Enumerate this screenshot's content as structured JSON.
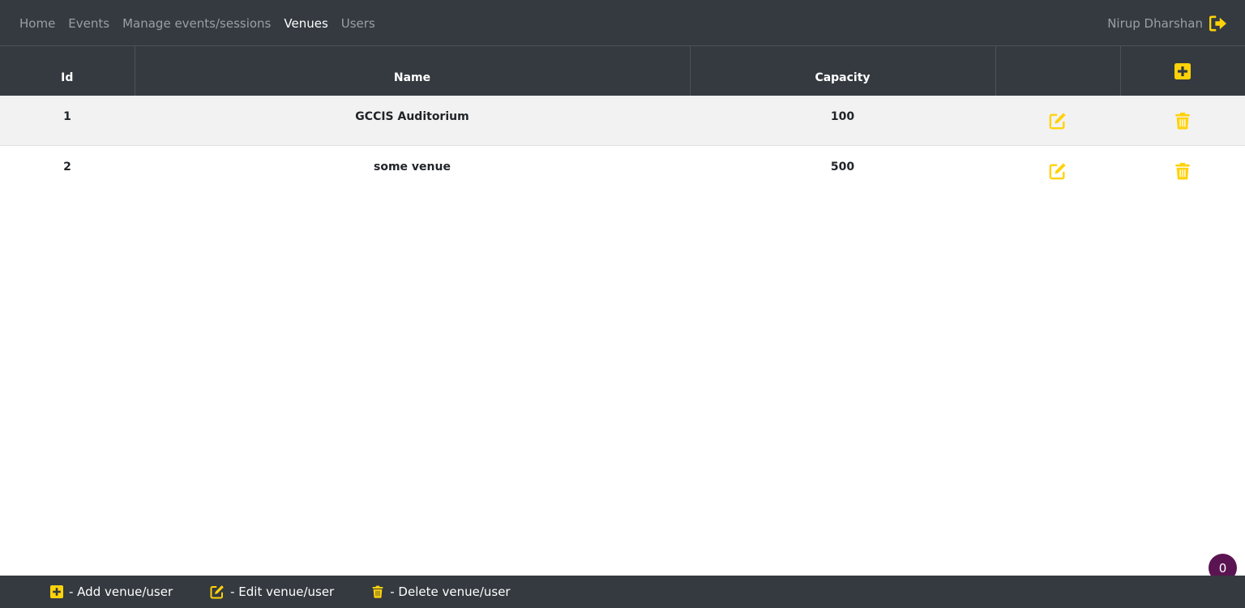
{
  "nav": {
    "links": [
      "Home",
      "Events",
      "Manage events/sessions",
      "Venues",
      "Users"
    ],
    "active": "Venues",
    "user_name": "Nirup Dharshan"
  },
  "table": {
    "headers": [
      "Id",
      "Name",
      "Capacity",
      "",
      ""
    ],
    "rows": [
      {
        "id": "1",
        "name": "GCCIS Auditorium",
        "capacity": "100"
      },
      {
        "id": "2",
        "name": "some venue",
        "capacity": "500"
      }
    ]
  },
  "footer": {
    "legend": [
      {
        "icon": "plus-square-icon",
        "label": "- Add venue/user"
      },
      {
        "icon": "edit-icon",
        "label": "- Edit venue/user"
      },
      {
        "icon": "trash-icon",
        "label": "- Delete venue/user"
      }
    ]
  },
  "badge": {
    "count": "0"
  },
  "colors": {
    "navbar_bg": "#343a40",
    "accent_yellow": "#ffd20a",
    "badge_bg": "#5b1452",
    "striped_row": "#f2f2f2"
  }
}
